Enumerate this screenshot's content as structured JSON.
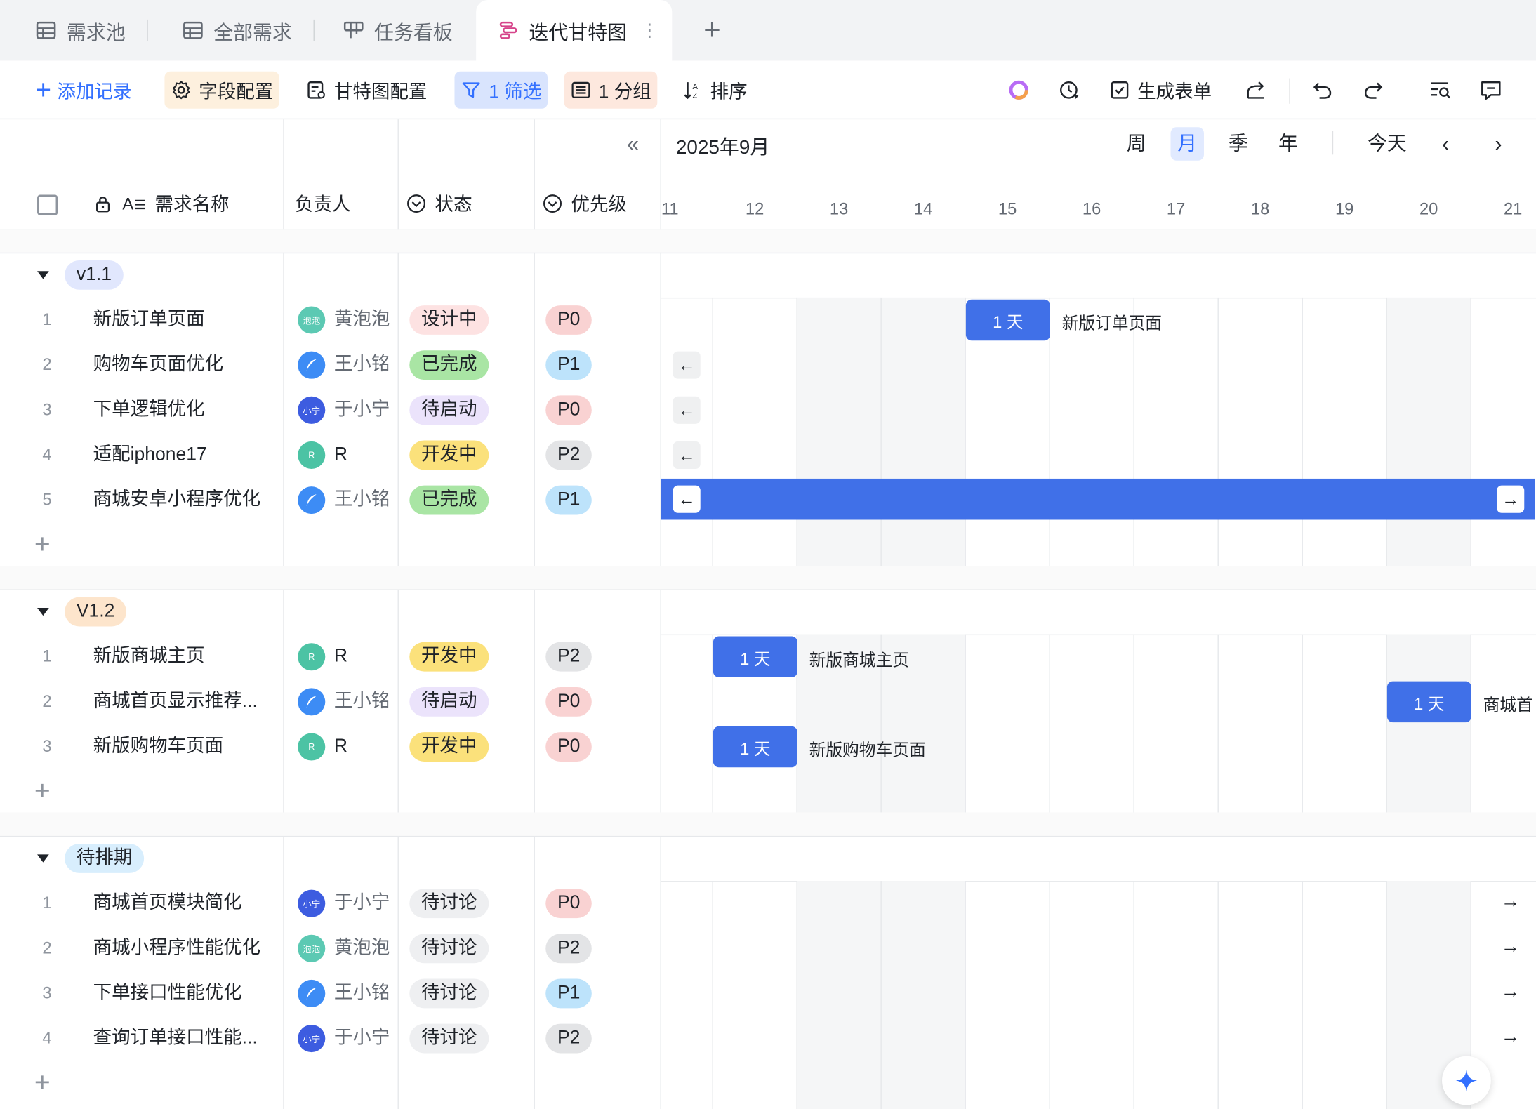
{
  "tabs": [
    {
      "label": "需求池",
      "icon": "table-icon"
    },
    {
      "label": "全部需求",
      "icon": "table-icon"
    },
    {
      "label": "任务看板",
      "icon": "kanban-icon"
    },
    {
      "label": "迭代甘特图",
      "icon": "gantt-icon",
      "active": true
    }
  ],
  "toolbar": {
    "add_record": "添加记录",
    "field_config": "字段配置",
    "gantt_config": "甘特图配置",
    "filter": "1 筛选",
    "group": "1 分组",
    "sort": "排序",
    "generate_form": "生成表单"
  },
  "colors": {
    "accent": "#3370ff",
    "bar": "#4070e8"
  },
  "columns": {
    "name": "需求名称",
    "owner": "负责人",
    "status": "状态",
    "priority": "优先级"
  },
  "gantt": {
    "month": "2025年9月",
    "views": [
      "周",
      "月",
      "季",
      "年"
    ],
    "active_view": "月",
    "today": "今天",
    "days": [
      "11",
      "12",
      "13",
      "14",
      "15",
      "16",
      "17",
      "18",
      "19",
      "20",
      "21"
    ],
    "bar_text": "1 天"
  },
  "groups": [
    {
      "name": "v1.1",
      "rows": [
        {
          "num": "1",
          "name": "新版订单页面",
          "owner": "黄泡泡",
          "avatar": "泡泡",
          "status": "设计中",
          "priority": "P0"
        },
        {
          "num": "2",
          "name": "购物车页面优化",
          "owner": "王小铭",
          "avatar": "",
          "status": "已完成",
          "priority": "P1"
        },
        {
          "num": "3",
          "name": "下单逻辑优化",
          "owner": "于小宁",
          "avatar": "小宁",
          "status": "待启动",
          "priority": "P0"
        },
        {
          "num": "4",
          "name": "适配iphone17",
          "owner": "R",
          "avatar": "R",
          "status": "开发中",
          "priority": "P2"
        },
        {
          "num": "5",
          "name": "商城安卓小程序优化",
          "owner": "王小铭",
          "avatar": "",
          "status": "已完成",
          "priority": "P1"
        }
      ]
    },
    {
      "name": "V1.2",
      "rows": [
        {
          "num": "1",
          "name": "新版商城主页",
          "owner": "R",
          "avatar": "R",
          "status": "开发中",
          "priority": "P2"
        },
        {
          "num": "2",
          "name": "商城首页显示推荐...",
          "owner": "王小铭",
          "avatar": "",
          "status": "待启动",
          "priority": "P0"
        },
        {
          "num": "3",
          "name": "新版购物车页面",
          "owner": "R",
          "avatar": "R",
          "status": "开发中",
          "priority": "P0"
        }
      ]
    },
    {
      "name": "待排期",
      "rows": [
        {
          "num": "1",
          "name": "商城首页模块简化",
          "owner": "于小宁",
          "avatar": "小宁",
          "status": "待讨论",
          "priority": "P0"
        },
        {
          "num": "2",
          "name": "商城小程序性能优化",
          "owner": "黄泡泡",
          "avatar": "泡泡",
          "status": "待讨论",
          "priority": "P2"
        },
        {
          "num": "3",
          "name": "下单接口性能优化",
          "owner": "王小铭",
          "avatar": "",
          "status": "待讨论",
          "priority": "P1"
        },
        {
          "num": "4",
          "name": "查询订单接口性能...",
          "owner": "于小宁",
          "avatar": "小宁",
          "status": "待讨论",
          "priority": "P2"
        }
      ]
    }
  ],
  "gantt_labels": {
    "g1r1": "新版订单页面",
    "g2r1": "新版商城主页",
    "g2r2": "商城首",
    "g2r3": "新版购物车页面"
  }
}
